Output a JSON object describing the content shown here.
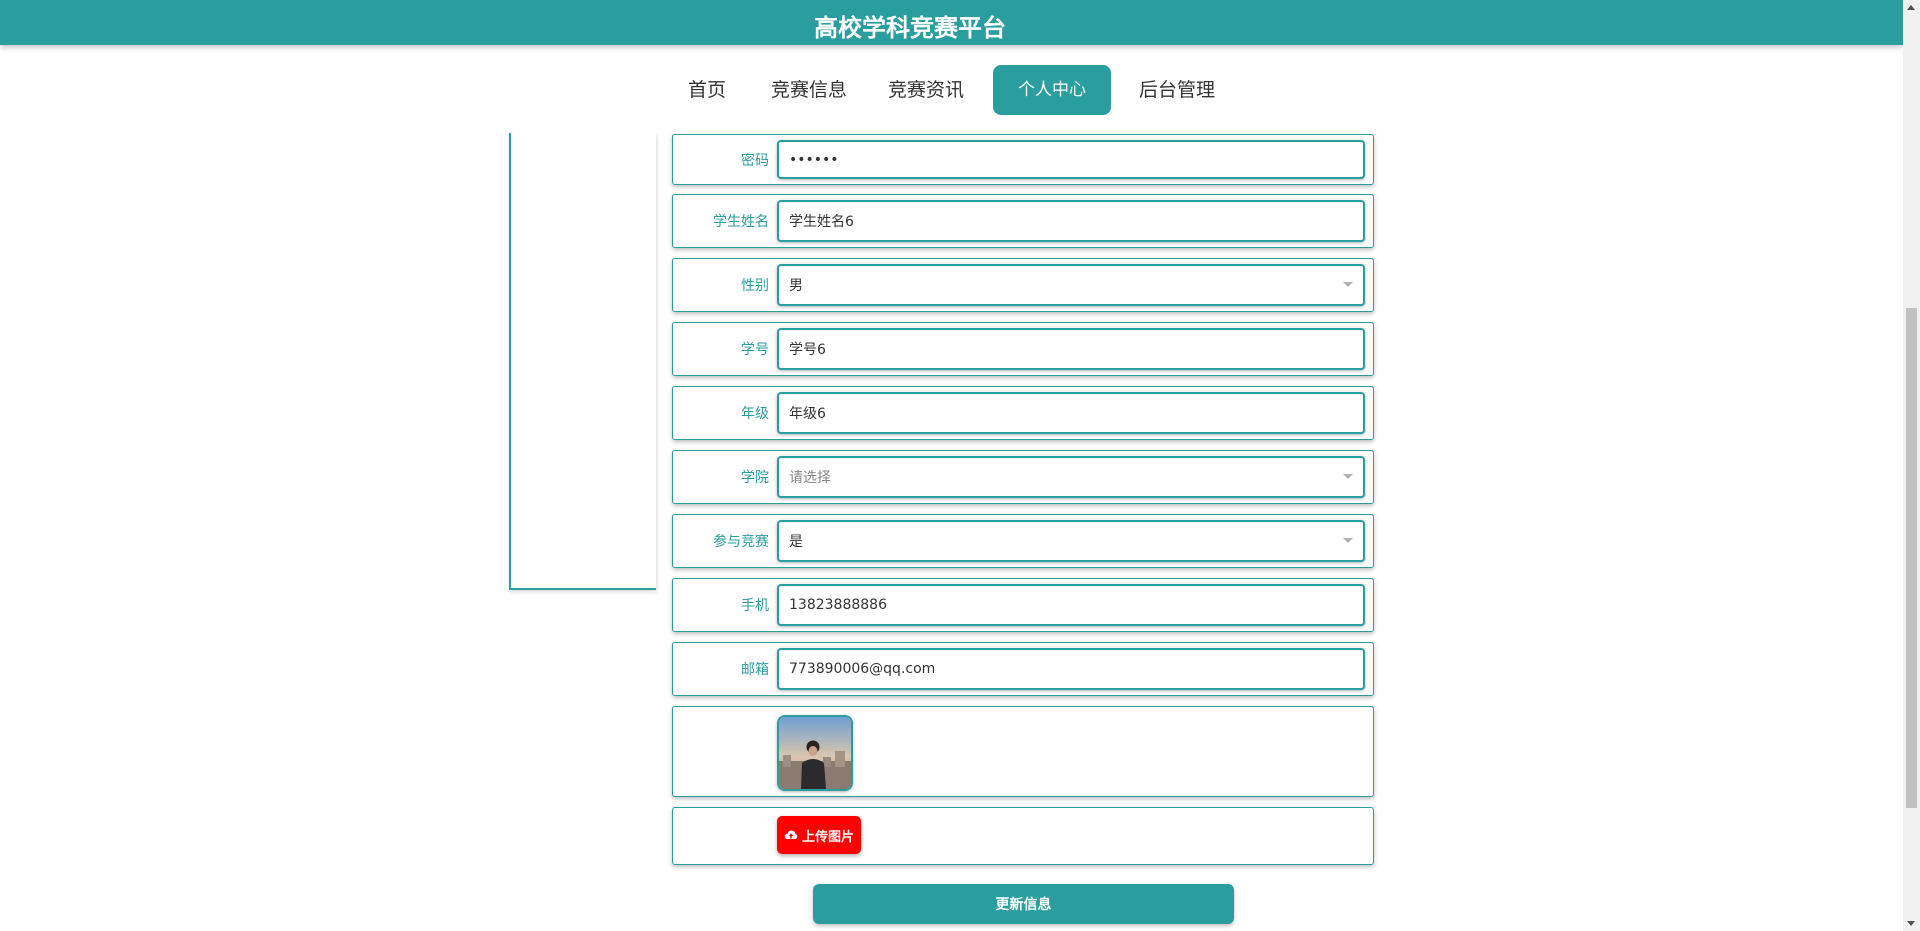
{
  "site": {
    "title": "高校学科竞赛平台"
  },
  "nav": {
    "items": [
      {
        "label": "首页"
      },
      {
        "label": "竞赛信息"
      },
      {
        "label": "竞赛资讯"
      },
      {
        "label": "个人中心"
      },
      {
        "label": "后台管理"
      }
    ],
    "active_index": 3
  },
  "form": {
    "password": {
      "label": "密码",
      "value": "••••••"
    },
    "student_name": {
      "label": "学生姓名",
      "value": "学生姓名6"
    },
    "gender": {
      "label": "性别",
      "value": "男"
    },
    "student_id": {
      "label": "学号",
      "value": "学号6"
    },
    "grade": {
      "label": "年级",
      "value": "年级6"
    },
    "college": {
      "label": "学院",
      "placeholder": "请选择"
    },
    "competing": {
      "label": "参与竞赛",
      "value": "是"
    },
    "phone": {
      "label": "手机",
      "value": "13823888886"
    },
    "email": {
      "label": "邮箱",
      "value": "773890006@qq.com"
    },
    "upload_label": "上传图片",
    "submit_label": "更新信息"
  },
  "colors": {
    "accent": "#2a9d9f",
    "upload_button": "#ff0000"
  },
  "icons": {
    "upload": "cloud-upload-icon",
    "select": "chevron-down-icon"
  }
}
